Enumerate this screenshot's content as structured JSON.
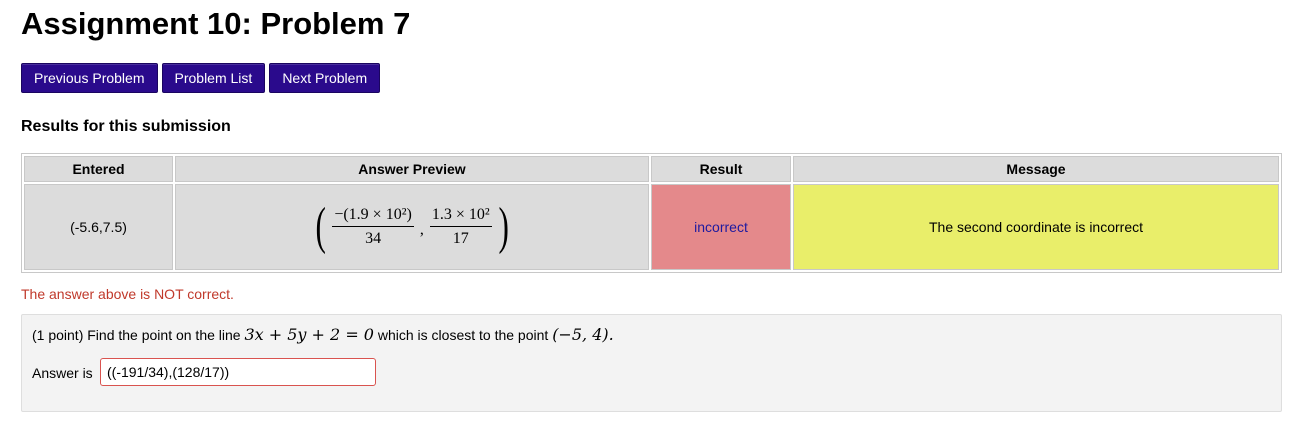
{
  "page": {
    "title": "Assignment 10: Problem 7"
  },
  "nav": {
    "previous": "Previous Problem",
    "list": "Problem List",
    "next": "Next Problem"
  },
  "results": {
    "heading": "Results for this submission",
    "headers": {
      "entered": "Entered",
      "preview": "Answer Preview",
      "result": "Result",
      "message": "Message"
    },
    "row": {
      "entered": "(-5.6,7.5)",
      "preview": {
        "frac1_num": "−(1.9 × 10²)",
        "frac1_den": "34",
        "frac2_num": "1.3 × 10²",
        "frac2_den": "17"
      },
      "result": "incorrect",
      "message": "The second coordinate is incorrect"
    }
  },
  "feedback": "The answer above is NOT correct.",
  "problem": {
    "points": "(1 point) Find the point on the line",
    "equation": "3x + 5y + 2 = 0",
    "middle": "which is closest to the point",
    "point": "(−5, 4).",
    "answer_label": "Answer is",
    "answer_value": "((-191/34),(128/17))"
  },
  "colors": {
    "button": "#2a0a8c",
    "incorrect_cell": "#e4898b",
    "message_cell": "#e9ee6a",
    "feedback_text": "#c0392b"
  }
}
